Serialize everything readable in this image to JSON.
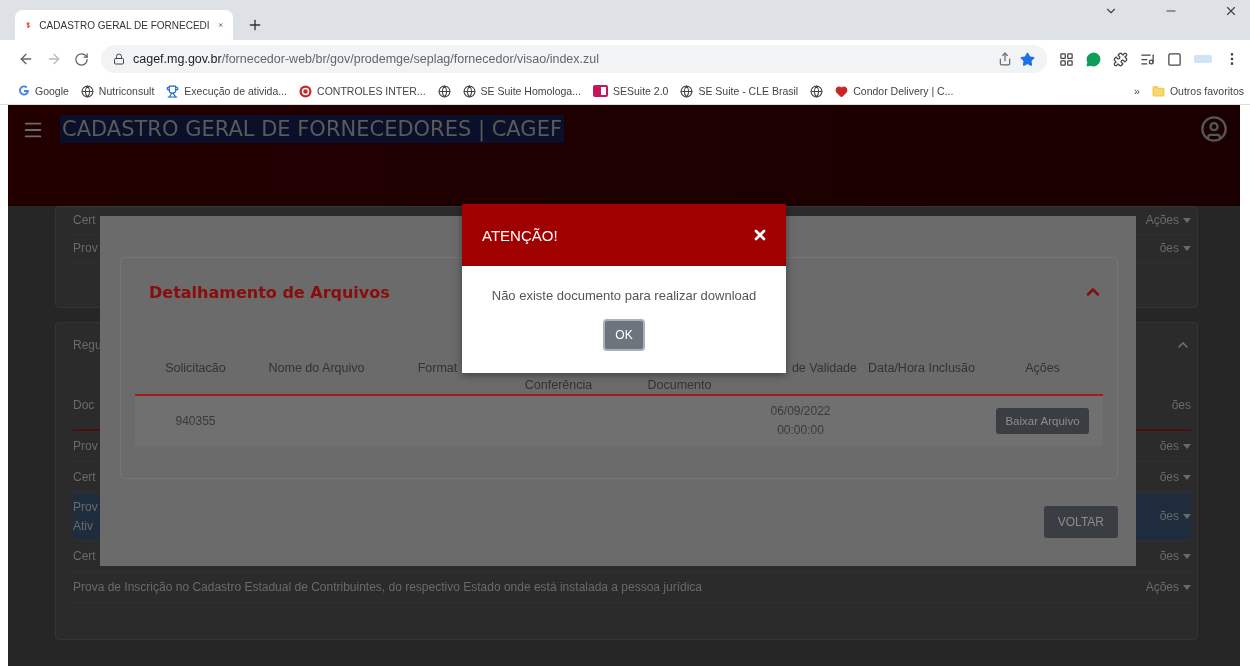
{
  "browser": {
    "tab_title": "CADASTRO GERAL DE FORNECEDI",
    "url_host": "cagef.mg.gov.br",
    "url_path": "/fornecedor-web/br/gov/prodemge/seplag/fornecedor/visao/index.zul",
    "bookmarks": [
      {
        "kind": "google",
        "label": "Google"
      },
      {
        "kind": "globe",
        "label": "Nutriconsult"
      },
      {
        "kind": "trophy",
        "label": "Execução de ativida..."
      },
      {
        "kind": "seal",
        "label": "CONTROLES INTER..."
      },
      {
        "kind": "globe"
      },
      {
        "kind": "globe",
        "label": "SE Suite Homologa..."
      },
      {
        "kind": "sf",
        "label": "SESuite 2.0"
      },
      {
        "kind": "globe",
        "label": "SE Suite - CLE Brasil"
      },
      {
        "kind": "globe"
      },
      {
        "kind": "heart",
        "label": "Condor Delivery | C..."
      }
    ],
    "more": "»",
    "other_bookmarks": "Outros favoritos"
  },
  "app_header": {
    "title": "CADASTRO GERAL DE FORNECEDORES | CAGEF"
  },
  "background": {
    "panels": [
      {
        "rows": [
          {
            "text": "Cert",
            "action": "Ações",
            "selected": false
          },
          {
            "text": "Prov",
            "action": "ões",
            "selected": false
          }
        ]
      },
      {
        "title": "Regu",
        "header": {
          "text": "Doc",
          "action": "ões"
        },
        "rows": [
          {
            "text": "Prov",
            "action": "ões",
            "selected": false
          },
          {
            "text": "Cert",
            "action": "ões",
            "selected": false
          },
          {
            "text": "Prov\nAtiv",
            "action": "ões",
            "selected": true
          },
          {
            "text": "Cert",
            "action": "ões",
            "selected": false
          },
          {
            "text": "Prova de Inscrição no Cadastro Estadual de Contribuintes, do respectivo Estado onde está instalada a pessoa jurídica",
            "action": "Ações",
            "selected": false
          }
        ]
      }
    ]
  },
  "files_dialog": {
    "title": "Detalhamento de Arquivos",
    "columns": [
      {
        "label": "Solicitacão",
        "kind": "full"
      },
      {
        "label": "Nome do Arquivo",
        "kind": "full"
      },
      {
        "label": "Format",
        "kind": "full"
      },
      {
        "label": "Conferência",
        "kind": "lower"
      },
      {
        "label": "Documento",
        "kind": "lower"
      },
      {
        "label": "de Validade",
        "kind": "right"
      },
      {
        "label": "Data/Hora Inclusão",
        "kind": "full"
      },
      {
        "label": "Ações",
        "kind": "full"
      }
    ],
    "rows": [
      {
        "request": "940355",
        "validity": [
          "06/09/2022",
          "00:00:00"
        ],
        "action": "Baixar Arquivo"
      }
    ],
    "back_button": "VOLTAR"
  },
  "alert": {
    "title": "ATENÇÃO!",
    "message": "Não existe documento para realizar download",
    "ok_button": "OK"
  }
}
